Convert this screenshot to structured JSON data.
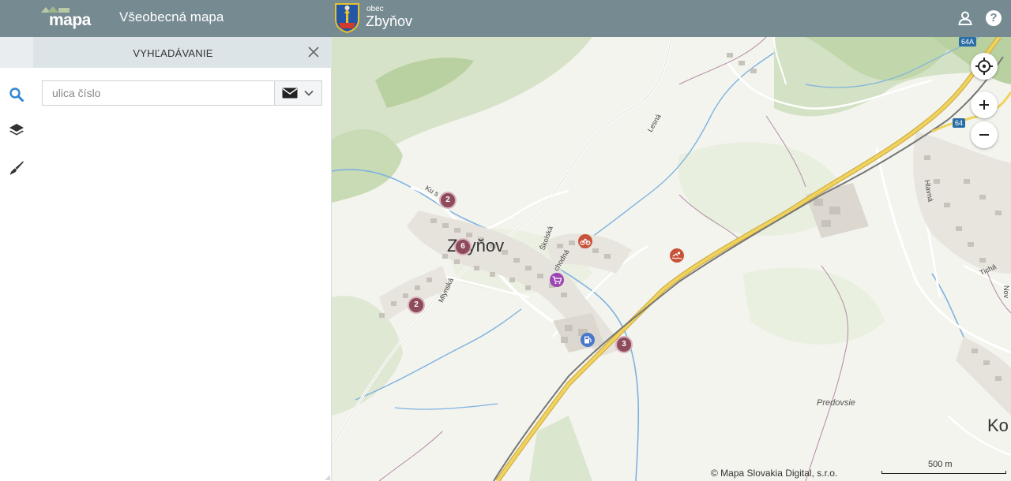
{
  "header": {
    "logo_text": "mapa",
    "app_title": "Všeobecná mapa",
    "municipality_kind": "obec",
    "municipality_name": "Zbyňov",
    "help_glyph": "?"
  },
  "icons": {
    "user": "user-icon",
    "help": "help-icon",
    "search": "search-icon",
    "layers": "layers-icon",
    "tools": "brush-icon",
    "close": "close-icon",
    "envelope": "envelope-icon",
    "chevron": "chevron-down-icon",
    "locate": "locate-icon",
    "zoom_in": "plus-icon",
    "zoom_out": "minus-icon"
  },
  "panel": {
    "title": "VYHĽADÁVANIE",
    "search": {
      "placeholder": "ulica číslo",
      "value": ""
    }
  },
  "map": {
    "place_labels": {
      "village": "Zbyňov",
      "partial_village": "Ko",
      "predovsie": "Predovsie"
    },
    "street_labels": {
      "lesna": "Lesná",
      "ku": "Ku s",
      "skolska": "Školská",
      "vychodna": "chodná",
      "mlynska": "Mlynská",
      "hlavna": "Hlavná",
      "ticha": "Tichá",
      "nov": "Nov"
    },
    "road_shields": [
      "64A",
      "64"
    ],
    "clusters": [
      {
        "count": "2"
      },
      {
        "count": "6"
      },
      {
        "count": "2"
      },
      {
        "count": "3"
      }
    ],
    "attribution": "© Mapa Slovakia Digital, s.r.o.",
    "scale_label": "500 m"
  },
  "colors": {
    "header": "#768a92",
    "cluster": "#8e4b5b",
    "poi_red": "#c8533a",
    "poi_purple": "#9b44b3",
    "poi_blue": "#4a78c9",
    "search_icon": "#2f86d6",
    "road_yellow": "#f1d25c",
    "rail": "#777777",
    "stream": "#7eb2e0"
  }
}
